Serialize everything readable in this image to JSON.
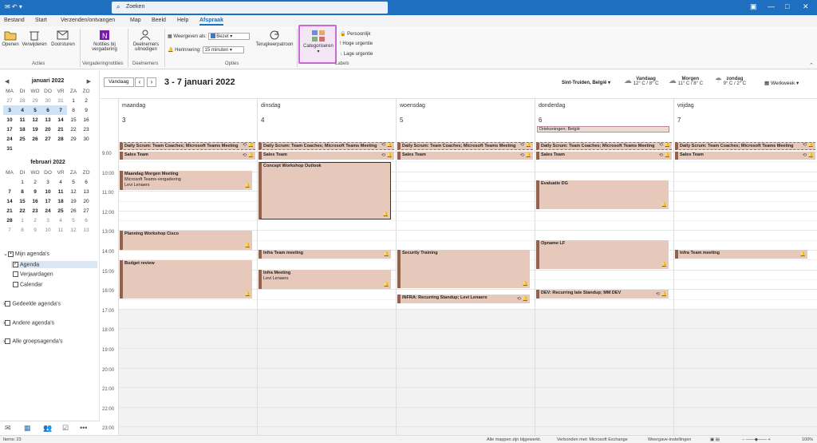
{
  "search": {
    "placeholder": "Zoeken"
  },
  "tabs": [
    "Bestand",
    "Start",
    "Verzenden/ontvangen",
    "Map",
    "Beeld",
    "Help",
    "Afspraak"
  ],
  "ribbon": {
    "open": "Openen",
    "delete": "Verwijderen",
    "forward": "Doorsturen",
    "acties": "Acties",
    "notes": "Notities bij vergadering",
    "notes_group": "Vergaderingnotities",
    "invite": "Deelnemers uitnodigen",
    "invite_group": "Deelnemers",
    "show_as_label": "Weergeven als:",
    "show_as_value": "Bezet",
    "reminder_label": "Herinnering:",
    "reminder_value": "15 minuten",
    "recurrence": "Terugkeerpatroon",
    "options_group": "Opties",
    "categorize": "Categoriseren",
    "private": "Persoonlijk",
    "high": "Hoge urgentie",
    "low": "Lage urgentie",
    "tags_group": "Labels"
  },
  "mini1": {
    "title": "januari 2022",
    "weekdays": [
      "MA",
      "DI",
      "WO",
      "DO",
      "VR",
      "ZA",
      "ZO"
    ],
    "weeks": [
      [
        "27",
        "28",
        "29",
        "30",
        "31",
        "1",
        "2"
      ],
      [
        "3",
        "4",
        "5",
        "6",
        "7",
        "8",
        "9"
      ],
      [
        "10",
        "11",
        "12",
        "13",
        "14",
        "15",
        "16"
      ],
      [
        "17",
        "18",
        "19",
        "20",
        "21",
        "22",
        "23"
      ],
      [
        "24",
        "25",
        "26",
        "27",
        "28",
        "29",
        "30"
      ],
      [
        "31",
        "",
        "",
        "",
        "",
        "",
        ""
      ]
    ]
  },
  "mini2": {
    "title": "februari 2022",
    "weekdays": [
      "MA",
      "DI",
      "WO",
      "DO",
      "VR",
      "ZA",
      "ZO"
    ],
    "weeks": [
      [
        "",
        "1",
        "2",
        "3",
        "4",
        "5",
        "6"
      ],
      [
        "7",
        "8",
        "9",
        "10",
        "11",
        "12",
        "13"
      ],
      [
        "14",
        "15",
        "16",
        "17",
        "18",
        "19",
        "20"
      ],
      [
        "21",
        "22",
        "23",
        "24",
        "25",
        "26",
        "27"
      ],
      [
        "28",
        "1",
        "2",
        "3",
        "4",
        "5",
        "6"
      ],
      [
        "7",
        "8",
        "9",
        "10",
        "11",
        "12",
        "13"
      ]
    ]
  },
  "folders": {
    "mine": "Mijn agenda's",
    "agenda": "Agenda",
    "birthdays": "Verjaardagen",
    "calendar": "Calendar",
    "shared": "Gedeelde agenda's",
    "other": "Andere agenda's",
    "groups": "Alle groepsagenda's"
  },
  "calhdr": {
    "today": "Vandaag",
    "range": "3 - 7 januari 2022",
    "location": "Sint-Truiden, België",
    "w1_day": "Vandaag",
    "w1_temp": "12° C / 8° C",
    "w2_day": "Morgen",
    "w2_temp": "11° C / 8° C",
    "w3_day": "zondag",
    "w3_temp": "9° C / 2° C",
    "view": "Werkweek"
  },
  "days": [
    {
      "name": "maandag",
      "date": "3"
    },
    {
      "name": "dinsdag",
      "date": "4"
    },
    {
      "name": "woensdag",
      "date": "5"
    },
    {
      "name": "donderdag",
      "date": "6"
    },
    {
      "name": "vrijdag",
      "date": "7"
    }
  ],
  "allday": "Driekoningen; België",
  "times": [
    "9:00",
    "10:00",
    "11:00",
    "12:00",
    "13:00",
    "14:00",
    "15:00",
    "16:00",
    "17:00",
    "18:00",
    "19:00",
    "20:00",
    "21:00",
    "22:00",
    "23:00"
  ],
  "events": {
    "scrum": "Daily Scrum: Team Coaches; Microsoft Teams Meeting",
    "sales": "Sales Team",
    "mon_morning": "Maandag Morgen Meeting",
    "mon_morning_l1": "Microsoft Teams-vergadering",
    "mon_morning_l2": "Levi Lenaers",
    "planning": "Planning Workshop Cisco",
    "budget": "Budget review",
    "concept": "Concept Workshop Outlook",
    "infra_team": "Infra Team meeting",
    "infra_meeting": "Infra Meeting",
    "infra_meeting_l": "Levi Lenaers",
    "security": "Security Training",
    "infra_standup": "INFRA: Recurring  Standup; Levi Lenaers",
    "evaluatie": "Evaluatie DG",
    "opname": "Opname LF",
    "dev_standup": "DEV: Recurring late Standup; MM DEV",
    "fri_infra": "Infra Team meeting"
  },
  "status": {
    "items": "Items: 23",
    "uptodate": "Alle mappen zijn bijgewerkt.",
    "connected": "Verbonden met: Microsoft Exchange",
    "display": "Weergave-instellingen",
    "zoom": "100%"
  }
}
